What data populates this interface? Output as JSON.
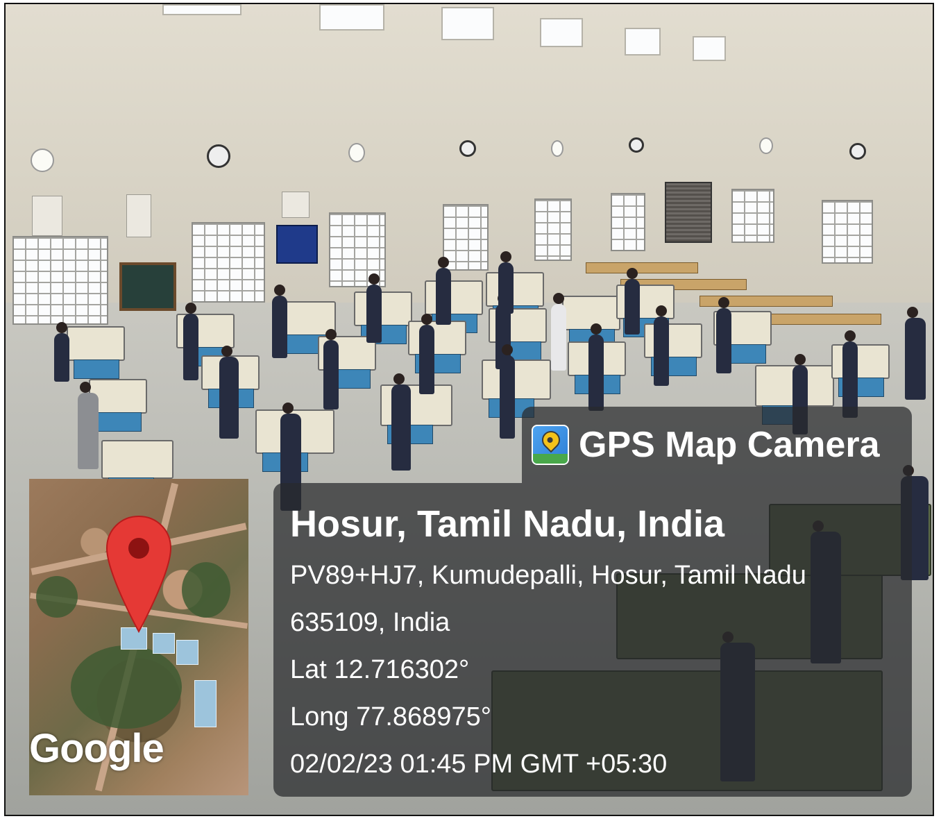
{
  "app_tag": {
    "name": "GPS Map Camera",
    "icon": "gps-map-camera-app-icon"
  },
  "location": {
    "title": "Hosur, Tamil Nadu, India",
    "address_line1": "PV89+HJ7, Kumudepalli, Hosur, Tamil Nadu",
    "address_line2": "635109, India",
    "latitude": "Lat 12.716302°",
    "longitude": "Long 77.868975°",
    "timestamp": "02/02/23 01:45 PM GMT +05:30"
  },
  "map": {
    "provider_logo": "Google",
    "marker_icon": "map-pin-icon",
    "marker_color": "#e53935"
  },
  "colors": {
    "overlay": "rgba(40,42,44,0.72)",
    "text": "#ffffff"
  }
}
